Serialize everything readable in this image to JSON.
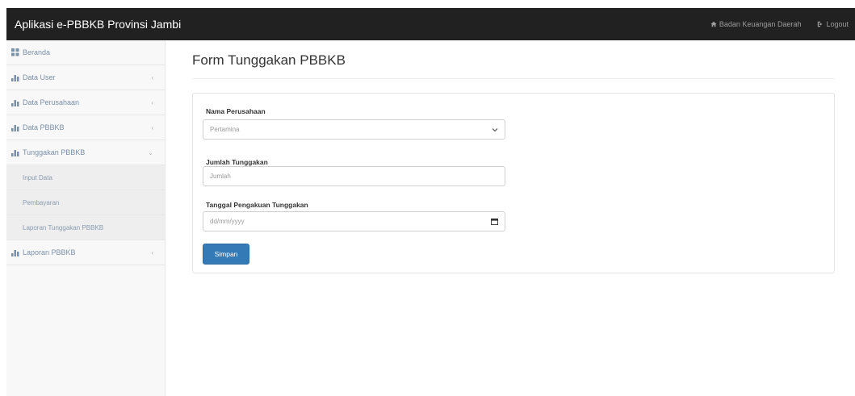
{
  "navbar": {
    "brand": "Aplikasi e-PBBKB Provinsi Jambi",
    "home_link": "Badan Keuangan Daerah",
    "logout_link": "Logout"
  },
  "sidebar": {
    "items": [
      {
        "label": "Beranda"
      },
      {
        "label": "Data User"
      },
      {
        "label": "Data Perusahaan"
      },
      {
        "label": "Data PBBKB"
      },
      {
        "label": "Tunggakan PBBKB"
      }
    ],
    "sub_items": [
      {
        "label": "Input Data"
      },
      {
        "label": "Pembayaran"
      },
      {
        "label": "Laporan Tunggakan PBBKB"
      }
    ],
    "last_item": {
      "label": "Laporan PBBKB"
    }
  },
  "main": {
    "title": "Form Tunggakan PBBKB",
    "company_label": "Nama Perusahaan",
    "company_value": "Pertamina",
    "amount_label": "Jumlah Tunggakan",
    "amount_placeholder": "Jumlah",
    "date_label": "Tanggal Pengakuan Tunggakan",
    "date_placeholder": "dd/mm/yyyy",
    "submit_label": "Simpan"
  },
  "colors": {
    "navbar_bg": "#212121",
    "primary_button": "#337ab7",
    "sidebar_bg": "#f8f8f8"
  }
}
